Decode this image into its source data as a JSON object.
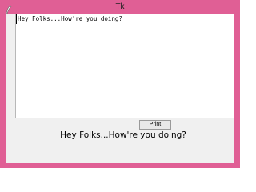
{
  "window": {
    "title": "Tk",
    "accent_color": "#e05f95",
    "app_icon": "tk-feather-icon"
  },
  "textarea": {
    "content": "Hey Folks...How're you doing?"
  },
  "print_button": {
    "label": "Print"
  },
  "output_label": {
    "text": "Hey Folks...How're you doing?"
  }
}
